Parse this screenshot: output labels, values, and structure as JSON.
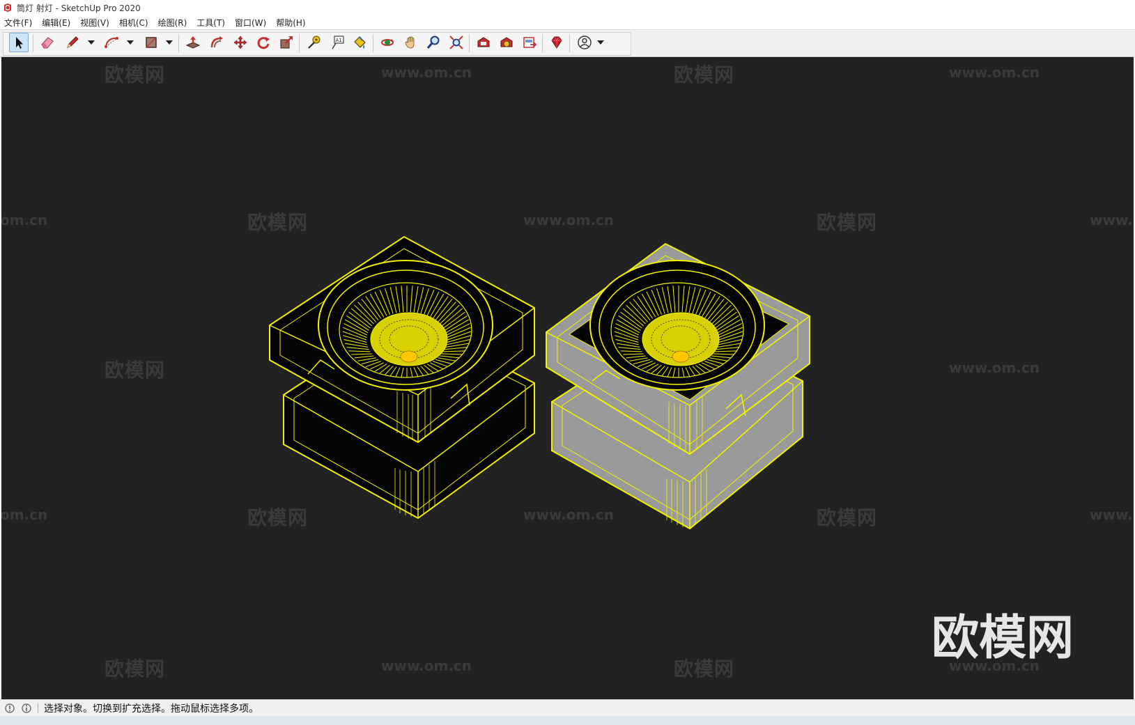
{
  "window": {
    "title": "筒灯 射灯 - SketchUp Pro 2020"
  },
  "menu": {
    "items": [
      {
        "label": "文件(F)"
      },
      {
        "label": "编辑(E)"
      },
      {
        "label": "视图(V)"
      },
      {
        "label": "相机(C)"
      },
      {
        "label": "绘图(R)"
      },
      {
        "label": "工具(T)"
      },
      {
        "label": "窗口(W)"
      },
      {
        "label": "帮助(H)"
      }
    ]
  },
  "toolbar": {
    "tools": [
      {
        "name": "select-tool",
        "icon": "arrow-cursor-icon",
        "active": true
      },
      {
        "name": "eraser-tool",
        "icon": "eraser-icon"
      },
      {
        "name": "line-tool",
        "icon": "pencil-icon"
      },
      {
        "name": "arc-tool",
        "icon": "arc-icon"
      },
      {
        "name": "rectangle-tool",
        "icon": "rectangle-icon"
      },
      {
        "name": "push-pull-tool",
        "icon": "push-pull-icon"
      },
      {
        "name": "offset-tool",
        "icon": "offset-icon"
      },
      {
        "name": "move-tool",
        "icon": "move-icon"
      },
      {
        "name": "rotate-tool",
        "icon": "rotate-icon"
      },
      {
        "name": "scale-tool",
        "icon": "scale-icon"
      },
      {
        "name": "tape-measure-tool",
        "icon": "tape-measure-icon"
      },
      {
        "name": "text-tool",
        "icon": "text-label-icon"
      },
      {
        "name": "paint-bucket-tool",
        "icon": "paint-bucket-icon"
      },
      {
        "name": "orbit-tool",
        "icon": "orbit-icon"
      },
      {
        "name": "pan-tool",
        "icon": "hand-icon"
      },
      {
        "name": "zoom-tool",
        "icon": "magnifier-icon"
      },
      {
        "name": "zoom-extents-tool",
        "icon": "zoom-extents-icon"
      },
      {
        "name": "warehouse-tool",
        "icon": "warehouse-icon"
      },
      {
        "name": "extension-warehouse-tool",
        "icon": "extension-icon"
      },
      {
        "name": "layout-send-tool",
        "icon": "layout-icon"
      },
      {
        "name": "ruby-console-tool",
        "icon": "ruby-gem-icon"
      },
      {
        "name": "account-tool",
        "icon": "user-avatar-icon"
      }
    ],
    "text_tool_glyph": "A1"
  },
  "watermarks": {
    "brand": "欧模网",
    "url": "www.om.cn",
    "url_partial_left": "om.cn",
    "url_partial_right": "www."
  },
  "status": {
    "message": "选择对象。切换到扩充选择。拖动鼠标选择多项。"
  },
  "colors": {
    "viewport_bg": "#222222",
    "wire": "#f2f200",
    "face_dark": "#050505",
    "face_gray": "#9a9a9a"
  }
}
